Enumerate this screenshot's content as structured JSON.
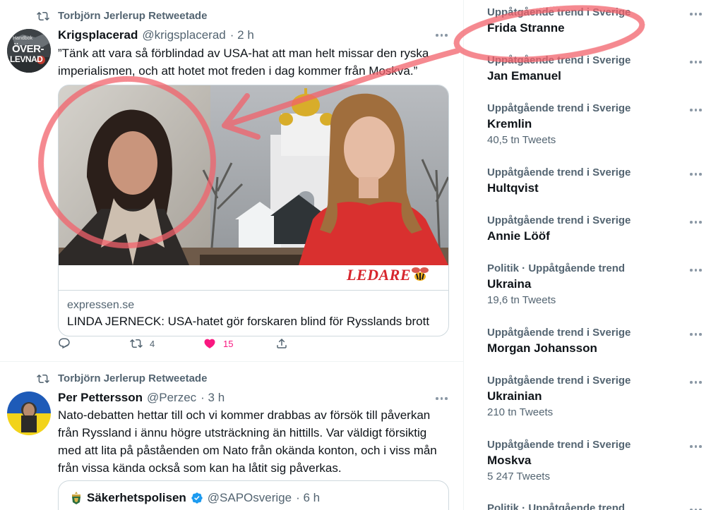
{
  "tweets": [
    {
      "retweeted_by": "Torbjörn Jerlerup Retweetade",
      "name": "Krigsplacerad",
      "handle": "@krigsplacerad",
      "time": "· 2 h",
      "avatar_text_1": "Handbok",
      "avatar_text_2": "ÖVER-",
      "avatar_text_3": "LEVNAD",
      "text_line1": "”Tänk att vara så förblindad av USA-hat att man helt missar den ryska",
      "text_line2": "imperialismen, och att hotet mot freden i dag kommer från Moskva.”",
      "card": {
        "badge": "LEDARE",
        "domain": "expressen.se",
        "title": "LINDA JERNECK: USA-hatet gör forskaren blind för Rysslands brott"
      },
      "retweets": "4",
      "likes": "15"
    },
    {
      "retweeted_by": "Torbjörn Jerlerup Retweetade",
      "name": "Per Pettersson",
      "handle": "@Perzec",
      "time": "· 3 h",
      "text_lines": [
        "Nato-debatten hettar till och vi kommer drabbas av försök till påverkan",
        "från Ryssland i ännu högre utsträckning än hittills. Var väldigt försiktig",
        "med att lita på påståenden om Nato från okända konton, och i viss mån",
        "från vissa kända också som kan ha låtit sig påverkas."
      ],
      "quote": {
        "name": "Säkerhetspolisen",
        "handle": "@SAPOsverige",
        "time": "· 6 h"
      }
    }
  ],
  "trends": [
    {
      "context": "Uppåtgående trend i Sverige",
      "name": "Frida Stranne",
      "count": ""
    },
    {
      "context": "Uppåtgående trend i Sverige",
      "name": "Jan Emanuel",
      "count": ""
    },
    {
      "context": "Uppåtgående trend i Sverige",
      "name": "Kremlin",
      "count": "40,5 tn Tweets"
    },
    {
      "context": "Uppåtgående trend i Sverige",
      "name": "Hultqvist",
      "count": ""
    },
    {
      "context": "Uppåtgående trend i Sverige",
      "name": "Annie Lööf",
      "count": ""
    },
    {
      "context": "Politik · Uppåtgående trend",
      "name": "Ukraina",
      "count": "19,6 tn Tweets"
    },
    {
      "context": "Uppåtgående trend i Sverige",
      "name": "Morgan Johansson",
      "count": ""
    },
    {
      "context": "Uppåtgående trend i Sverige",
      "name": "Ukrainian",
      "count": "210 tn Tweets"
    },
    {
      "context": "Uppåtgående trend i Sverige",
      "name": "Moskva",
      "count": "5 247 Tweets"
    },
    {
      "context": "Politik · Uppåtgående trend",
      "name": "",
      "count": ""
    }
  ],
  "colors": {
    "like_pink": "#f91880",
    "annotation_red": "#f2626b",
    "secondary_text": "#536471",
    "verified_blue": "#1d9bf0"
  }
}
